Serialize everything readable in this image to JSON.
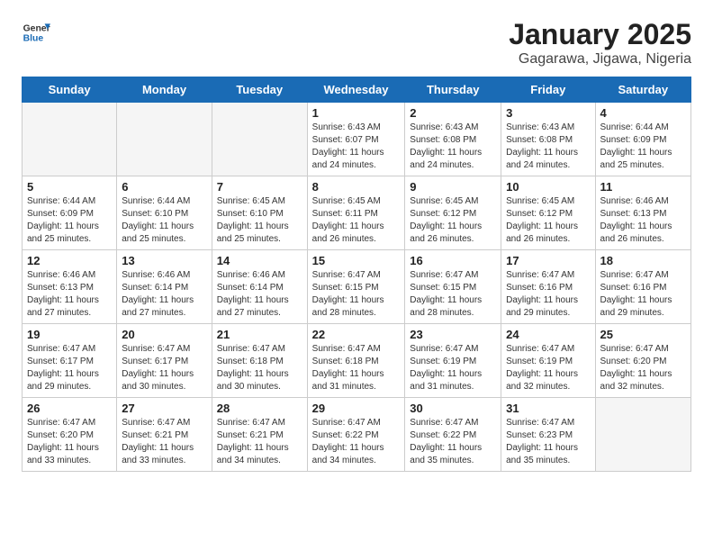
{
  "header": {
    "logo_line1": "General",
    "logo_line2": "Blue",
    "month_title": "January 2025",
    "subtitle": "Gagarawa, Jigawa, Nigeria"
  },
  "weekdays": [
    "Sunday",
    "Monday",
    "Tuesday",
    "Wednesday",
    "Thursday",
    "Friday",
    "Saturday"
  ],
  "weeks": [
    [
      {
        "day": "",
        "info": ""
      },
      {
        "day": "",
        "info": ""
      },
      {
        "day": "",
        "info": ""
      },
      {
        "day": "1",
        "info": "Sunrise: 6:43 AM\nSunset: 6:07 PM\nDaylight: 11 hours\nand 24 minutes."
      },
      {
        "day": "2",
        "info": "Sunrise: 6:43 AM\nSunset: 6:08 PM\nDaylight: 11 hours\nand 24 minutes."
      },
      {
        "day": "3",
        "info": "Sunrise: 6:43 AM\nSunset: 6:08 PM\nDaylight: 11 hours\nand 24 minutes."
      },
      {
        "day": "4",
        "info": "Sunrise: 6:44 AM\nSunset: 6:09 PM\nDaylight: 11 hours\nand 25 minutes."
      }
    ],
    [
      {
        "day": "5",
        "info": "Sunrise: 6:44 AM\nSunset: 6:09 PM\nDaylight: 11 hours\nand 25 minutes."
      },
      {
        "day": "6",
        "info": "Sunrise: 6:44 AM\nSunset: 6:10 PM\nDaylight: 11 hours\nand 25 minutes."
      },
      {
        "day": "7",
        "info": "Sunrise: 6:45 AM\nSunset: 6:10 PM\nDaylight: 11 hours\nand 25 minutes."
      },
      {
        "day": "8",
        "info": "Sunrise: 6:45 AM\nSunset: 6:11 PM\nDaylight: 11 hours\nand 26 minutes."
      },
      {
        "day": "9",
        "info": "Sunrise: 6:45 AM\nSunset: 6:12 PM\nDaylight: 11 hours\nand 26 minutes."
      },
      {
        "day": "10",
        "info": "Sunrise: 6:45 AM\nSunset: 6:12 PM\nDaylight: 11 hours\nand 26 minutes."
      },
      {
        "day": "11",
        "info": "Sunrise: 6:46 AM\nSunset: 6:13 PM\nDaylight: 11 hours\nand 26 minutes."
      }
    ],
    [
      {
        "day": "12",
        "info": "Sunrise: 6:46 AM\nSunset: 6:13 PM\nDaylight: 11 hours\nand 27 minutes."
      },
      {
        "day": "13",
        "info": "Sunrise: 6:46 AM\nSunset: 6:14 PM\nDaylight: 11 hours\nand 27 minutes."
      },
      {
        "day": "14",
        "info": "Sunrise: 6:46 AM\nSunset: 6:14 PM\nDaylight: 11 hours\nand 27 minutes."
      },
      {
        "day": "15",
        "info": "Sunrise: 6:47 AM\nSunset: 6:15 PM\nDaylight: 11 hours\nand 28 minutes."
      },
      {
        "day": "16",
        "info": "Sunrise: 6:47 AM\nSunset: 6:15 PM\nDaylight: 11 hours\nand 28 minutes."
      },
      {
        "day": "17",
        "info": "Sunrise: 6:47 AM\nSunset: 6:16 PM\nDaylight: 11 hours\nand 29 minutes."
      },
      {
        "day": "18",
        "info": "Sunrise: 6:47 AM\nSunset: 6:16 PM\nDaylight: 11 hours\nand 29 minutes."
      }
    ],
    [
      {
        "day": "19",
        "info": "Sunrise: 6:47 AM\nSunset: 6:17 PM\nDaylight: 11 hours\nand 29 minutes."
      },
      {
        "day": "20",
        "info": "Sunrise: 6:47 AM\nSunset: 6:17 PM\nDaylight: 11 hours\nand 30 minutes."
      },
      {
        "day": "21",
        "info": "Sunrise: 6:47 AM\nSunset: 6:18 PM\nDaylight: 11 hours\nand 30 minutes."
      },
      {
        "day": "22",
        "info": "Sunrise: 6:47 AM\nSunset: 6:18 PM\nDaylight: 11 hours\nand 31 minutes."
      },
      {
        "day": "23",
        "info": "Sunrise: 6:47 AM\nSunset: 6:19 PM\nDaylight: 11 hours\nand 31 minutes."
      },
      {
        "day": "24",
        "info": "Sunrise: 6:47 AM\nSunset: 6:19 PM\nDaylight: 11 hours\nand 32 minutes."
      },
      {
        "day": "25",
        "info": "Sunrise: 6:47 AM\nSunset: 6:20 PM\nDaylight: 11 hours\nand 32 minutes."
      }
    ],
    [
      {
        "day": "26",
        "info": "Sunrise: 6:47 AM\nSunset: 6:20 PM\nDaylight: 11 hours\nand 33 minutes."
      },
      {
        "day": "27",
        "info": "Sunrise: 6:47 AM\nSunset: 6:21 PM\nDaylight: 11 hours\nand 33 minutes."
      },
      {
        "day": "28",
        "info": "Sunrise: 6:47 AM\nSunset: 6:21 PM\nDaylight: 11 hours\nand 34 minutes."
      },
      {
        "day": "29",
        "info": "Sunrise: 6:47 AM\nSunset: 6:22 PM\nDaylight: 11 hours\nand 34 minutes."
      },
      {
        "day": "30",
        "info": "Sunrise: 6:47 AM\nSunset: 6:22 PM\nDaylight: 11 hours\nand 35 minutes."
      },
      {
        "day": "31",
        "info": "Sunrise: 6:47 AM\nSunset: 6:23 PM\nDaylight: 11 hours\nand 35 minutes."
      },
      {
        "day": "",
        "info": ""
      }
    ]
  ]
}
